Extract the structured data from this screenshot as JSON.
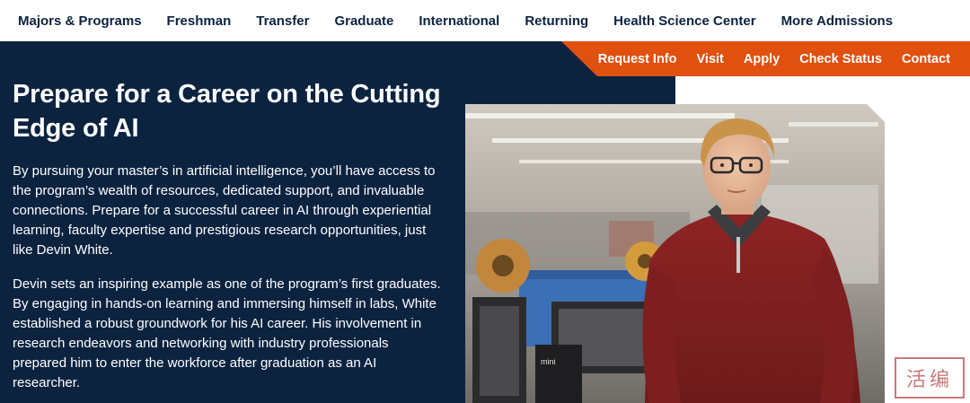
{
  "topnav": {
    "items": [
      {
        "label": "Majors & Programs"
      },
      {
        "label": "Freshman"
      },
      {
        "label": "Transfer"
      },
      {
        "label": "Graduate"
      },
      {
        "label": "International"
      },
      {
        "label": "Returning"
      },
      {
        "label": "Health Science Center"
      },
      {
        "label": "More Admissions"
      }
    ]
  },
  "utility": {
    "items": [
      {
        "label": "Request Info"
      },
      {
        "label": "Visit"
      },
      {
        "label": "Apply"
      },
      {
        "label": "Check Status"
      },
      {
        "label": "Contact"
      }
    ]
  },
  "hero": {
    "headline": "Prepare for a Career on the Cutting Edge of AI",
    "paragraph1": "By pursuing your master’s in artificial intelligence, you’ll have access to the program’s wealth of resources, dedicated support, and invaluable connections. Prepare for a successful career in AI through experiential learning, faculty expertise and prestigious research opportunities, just like Devin White.",
    "paragraph2": "Devin sets an inspiring example as one of the program’s first graduates. By engaging in hands-on learning and immersing himself in labs, White established a robust groundwork for his AI career. His involvement in research endeavors and networking with industry professionals prepared him to enter the workforce after graduation as an AI researcher.",
    "photo_label": "mini"
  },
  "watermark": "活编",
  "colors": {
    "navy": "#0c2340",
    "orange": "#e0500f",
    "white": "#ffffff"
  }
}
